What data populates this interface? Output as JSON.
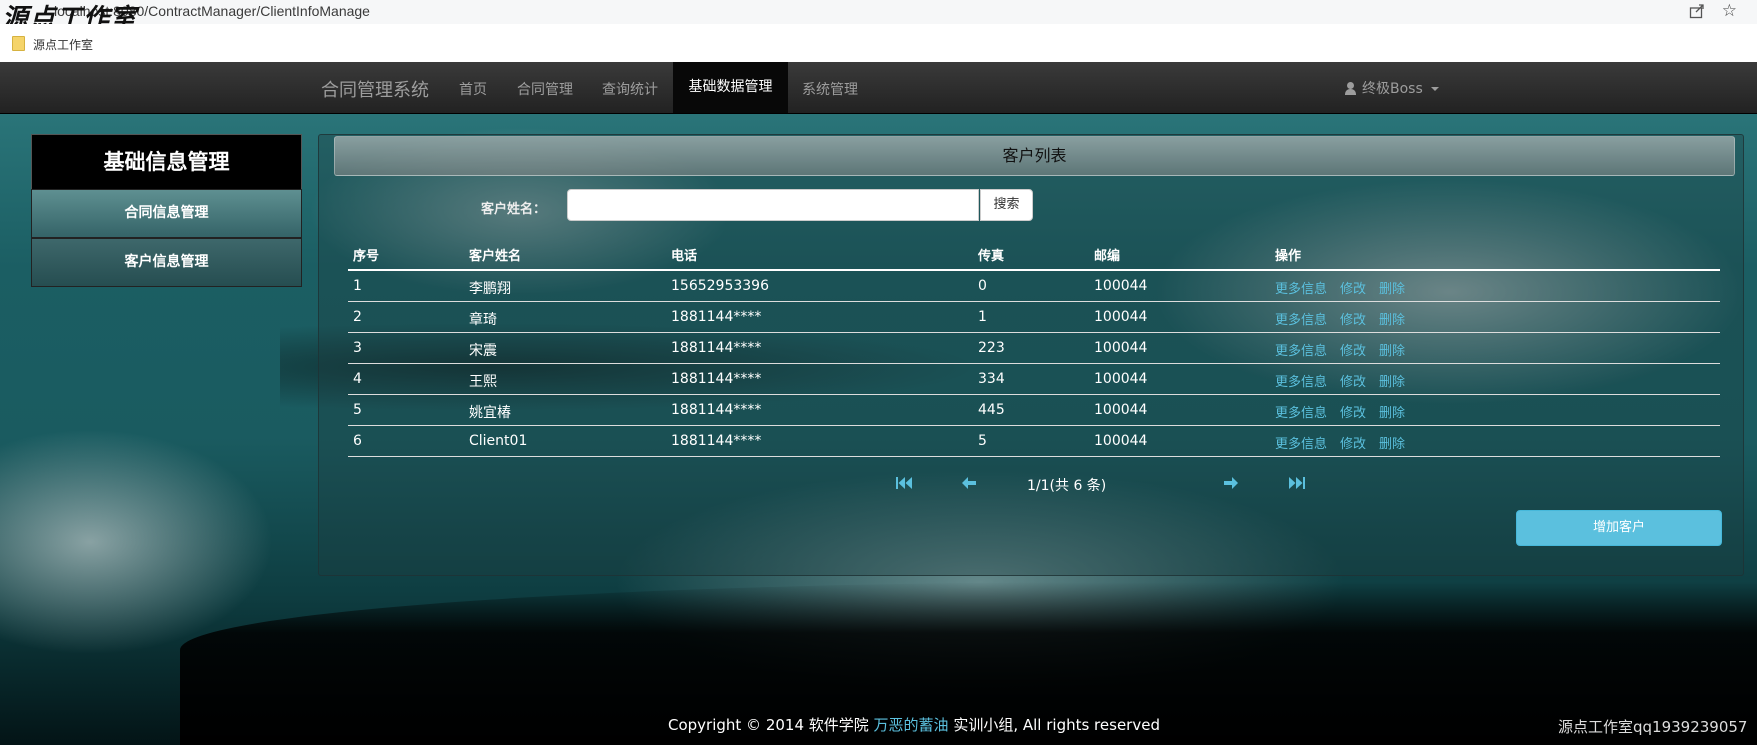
{
  "browser": {
    "watermark": "源点工作室",
    "url": "localhost:8080/ContractManager/ClientInfoManage",
    "bookmark": "源点工作室"
  },
  "navbar": {
    "brand": "合同管理系统",
    "items": [
      "首页",
      "合同管理",
      "查询统计",
      "基础数据管理",
      "系统管理"
    ],
    "active": "基础数据管理",
    "user": "终极Boss"
  },
  "sidebar": {
    "title": "基础信息管理",
    "items": [
      "合同信息管理",
      "客户信息管理"
    ]
  },
  "panel": {
    "title": "客户列表",
    "search_label": "客户姓名：",
    "search_value": "",
    "search_button": "搜索"
  },
  "table": {
    "headers": [
      "序号",
      "客户姓名",
      "电话",
      "传真",
      "邮编",
      "操作"
    ],
    "rows": [
      {
        "id": "1",
        "name": "李鹏翔",
        "phone": "15652953396",
        "fax": "0",
        "zip": "100044"
      },
      {
        "id": "2",
        "name": "章琦",
        "phone": "1881144****",
        "fax": "1",
        "zip": "100044"
      },
      {
        "id": "3",
        "name": "宋震",
        "phone": "1881144****",
        "fax": "223",
        "zip": "100044"
      },
      {
        "id": "4",
        "name": "王熙",
        "phone": "1881144****",
        "fax": "334",
        "zip": "100044"
      },
      {
        "id": "5",
        "name": "姚宜椿",
        "phone": "1881144****",
        "fax": "445",
        "zip": "100044"
      },
      {
        "id": "6",
        "name": "Client01",
        "phone": "1881144****",
        "fax": "5",
        "zip": "100044"
      }
    ],
    "actions": [
      "更多信息",
      "修改",
      "删除"
    ]
  },
  "pager": {
    "text": "1/1(共 6 条)"
  },
  "add_button": "增加客户",
  "footer": {
    "prefix": "Copyright © 2014 软件学院 ",
    "link": "万恶的蓄油",
    "suffix": " 实训小组, All rights reserved"
  },
  "watermark_bottom": "源点工作室qq1939239057"
}
